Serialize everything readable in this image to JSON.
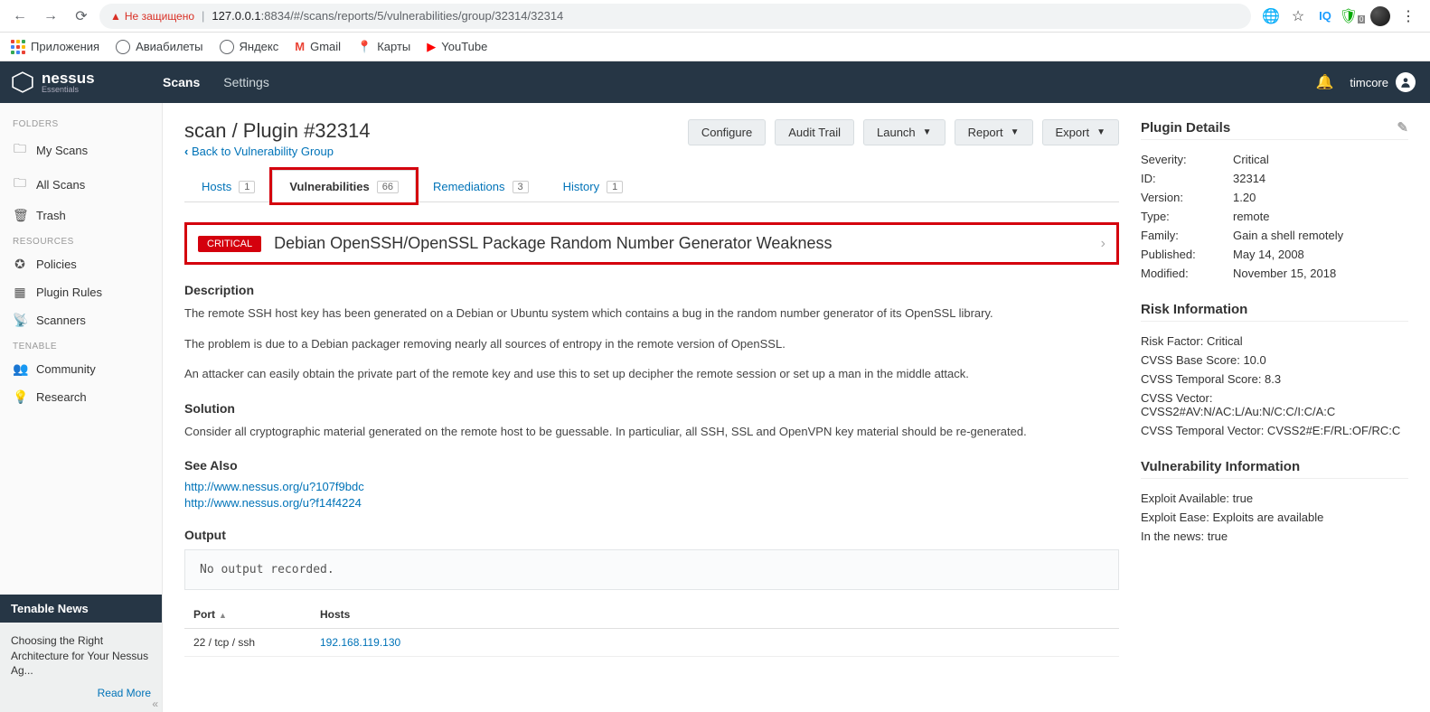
{
  "browser": {
    "warn_text": "Не защищено",
    "url_host": "127.0.0.1",
    "url_port": ":8834",
    "url_path": "/#/scans/reports/5/vulnerabilities/group/32314/32314",
    "bookmarks": {
      "apps": "Приложения",
      "avia": "Авиабилеты",
      "yandex": "Яндекс",
      "gmail": "Gmail",
      "maps": "Карты",
      "youtube": "YouTube"
    }
  },
  "top": {
    "brand": "nessus",
    "brand_sub": "Essentials",
    "nav_scans": "Scans",
    "nav_settings": "Settings",
    "username": "timcore"
  },
  "sidebar": {
    "h_folders": "FOLDERS",
    "my_scans": "My Scans",
    "all_scans": "All Scans",
    "trash": "Trash",
    "h_resources": "RESOURCES",
    "policies": "Policies",
    "plugin_rules": "Plugin Rules",
    "scanners": "Scanners",
    "h_tenable": "TENABLE",
    "community": "Community",
    "research": "Research",
    "news_title": "Tenable News",
    "news_body": "Choosing the Right Architecture for Your Nessus Ag...",
    "read_more": "Read More"
  },
  "header": {
    "title": "scan / Plugin #32314",
    "back": "Back to Vulnerability Group",
    "btn_configure": "Configure",
    "btn_audit": "Audit Trail",
    "btn_launch": "Launch",
    "btn_report": "Report",
    "btn_export": "Export"
  },
  "tabs": {
    "hosts": "Hosts",
    "hosts_c": "1",
    "vuln": "Vulnerabilities",
    "vuln_c": "66",
    "rem": "Remediations",
    "rem_c": "3",
    "hist": "History",
    "hist_c": "1"
  },
  "vuln": {
    "severity": "CRITICAL",
    "title": "Debian OpenSSH/OpenSSL Package Random Number Generator Weakness"
  },
  "desc": {
    "h": "Description",
    "p1": "The remote SSH host key has been generated on a Debian or Ubuntu system which contains a bug in the random number generator of its OpenSSL library.",
    "p2": "The problem is due to a Debian packager removing nearly all sources of entropy in the remote version of OpenSSL.",
    "p3": "An attacker can easily obtain the private part of the remote key and use this to set up decipher the remote session or set up a man in the middle attack."
  },
  "solution": {
    "h": "Solution",
    "p": "Consider all cryptographic material generated on the remote host to be guessable. In particuliar, all SSH, SSL and OpenVPN key material should be re-generated."
  },
  "seealso": {
    "h": "See Also",
    "l1": "http://www.nessus.org/u?107f9bdc",
    "l2": "http://www.nessus.org/u?f14f4224"
  },
  "output": {
    "h": "Output",
    "text": "No output recorded.",
    "col_port": "Port",
    "col_hosts": "Hosts",
    "row_port": "22 / tcp / ssh",
    "row_host": "192.168.119.130"
  },
  "details": {
    "h": "Plugin Details",
    "severity_k": "Severity:",
    "severity_v": "Critical",
    "id_k": "ID:",
    "id_v": "32314",
    "version_k": "Version:",
    "version_v": "1.20",
    "type_k": "Type:",
    "type_v": "remote",
    "family_k": "Family:",
    "family_v": "Gain a shell remotely",
    "pub_k": "Published:",
    "pub_v": "May 14, 2008",
    "mod_k": "Modified:",
    "mod_v": "November 15, 2018"
  },
  "risk": {
    "h": "Risk Information",
    "rf": "Risk Factor: Critical",
    "base": "CVSS Base Score: 10.0",
    "temp": "CVSS Temporal Score: 8.3",
    "vec": "CVSS Vector: CVSS2#AV:N/AC:L/Au:N/C:C/I:C/A:C",
    "tvec": "CVSS Temporal Vector: CVSS2#E:F/RL:OF/RC:C"
  },
  "vinfo": {
    "h": "Vulnerability Information",
    "ea": "Exploit Available: true",
    "ee": "Exploit Ease: Exploits are available",
    "news": "In the news: true"
  }
}
